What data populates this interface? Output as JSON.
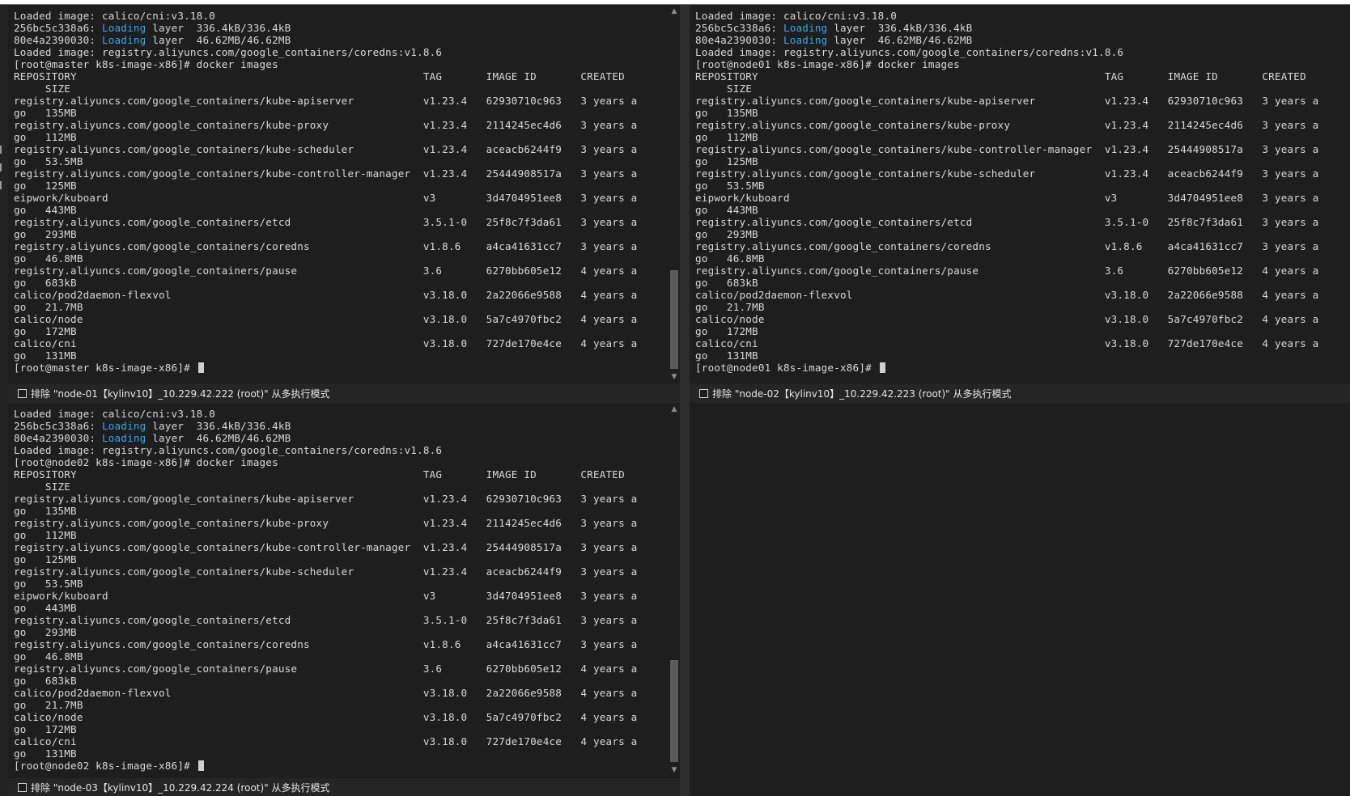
{
  "panes": [
    {
      "id": "pane-master",
      "lines": [
        {
          "t": "Loaded image: calico/cni:v3.18.0"
        },
        {
          "segments": [
            "256bc5c338a6: ",
            "Loading",
            " layer  336.4kB/336.4kB"
          ]
        },
        {
          "segments": [
            "80e4a2390030: ",
            "Loading",
            " layer  46.62MB/46.62MB"
          ]
        },
        {
          "t": "Loaded image: registry.aliyuncs.com/google_containers/coredns:v1.8.6"
        },
        {
          "t": "[root@master k8s-image-x86]# docker images"
        },
        {
          "t": "REPOSITORY                                                       TAG       IMAGE ID       CREATED"
        },
        {
          "t": "     SIZE"
        },
        {
          "t": "registry.aliyuncs.com/google_containers/kube-apiserver           v1.23.4   62930710c963   3 years a"
        },
        {
          "t": "go   135MB"
        },
        {
          "t": "registry.aliyuncs.com/google_containers/kube-proxy               v1.23.4   2114245ec4d6   3 years a"
        },
        {
          "t": "go   112MB"
        },
        {
          "t": "registry.aliyuncs.com/google_containers/kube-scheduler           v1.23.4   aceacb6244f9   3 years a"
        },
        {
          "t": "go   53.5MB"
        },
        {
          "t": "registry.aliyuncs.com/google_containers/kube-controller-manager  v1.23.4   25444908517a   3 years a"
        },
        {
          "t": "go   125MB"
        },
        {
          "t": "eipwork/kuboard                                                  v3        3d4704951ee8   3 years a"
        },
        {
          "t": "go   443MB"
        },
        {
          "t": "registry.aliyuncs.com/google_containers/etcd                     3.5.1-0   25f8c7f3da61   3 years a"
        },
        {
          "t": "go   293MB"
        },
        {
          "t": "registry.aliyuncs.com/google_containers/coredns                  v1.8.6    a4ca41631cc7   3 years a"
        },
        {
          "t": "go   46.8MB"
        },
        {
          "t": "registry.aliyuncs.com/google_containers/pause                    3.6       6270bb605e12   4 years a"
        },
        {
          "t": "go   683kB"
        },
        {
          "t": "calico/pod2daemon-flexvol                                        v3.18.0   2a22066e9588   4 years a"
        },
        {
          "t": "go   21.7MB"
        },
        {
          "t": "calico/node                                                      v3.18.0   5a7c4970fbc2   4 years a"
        },
        {
          "t": "go   172MB"
        },
        {
          "t": "calico/cni                                                       v3.18.0   727de170e4ce   4 years a"
        },
        {
          "t": "go   131MB"
        },
        {
          "t": "[root@master k8s-image-x86]# ",
          "cursor": true
        }
      ],
      "status": "排除 \"node-01【kylinv10】_10.229.42.222 (root)\" 从多执行模式"
    },
    {
      "id": "pane-node01",
      "lines": [
        {
          "t": "Loaded image: calico/cni:v3.18.0"
        },
        {
          "segments": [
            "256bc5c338a6: ",
            "Loading",
            " layer  336.4kB/336.4kB"
          ]
        },
        {
          "segments": [
            "80e4a2390030: ",
            "Loading",
            " layer  46.62MB/46.62MB"
          ]
        },
        {
          "t": "Loaded image: registry.aliyuncs.com/google_containers/coredns:v1.8.6"
        },
        {
          "t": "[root@node01 k8s-image-x86]# docker images"
        },
        {
          "t": "REPOSITORY                                                       TAG       IMAGE ID       CREATED"
        },
        {
          "t": "     SIZE"
        },
        {
          "t": "registry.aliyuncs.com/google_containers/kube-apiserver           v1.23.4   62930710c963   3 years a"
        },
        {
          "t": "go   135MB"
        },
        {
          "t": "registry.aliyuncs.com/google_containers/kube-proxy               v1.23.4   2114245ec4d6   3 years a"
        },
        {
          "t": "go   112MB"
        },
        {
          "t": "registry.aliyuncs.com/google_containers/kube-controller-manager  v1.23.4   25444908517a   3 years a"
        },
        {
          "t": "go   125MB"
        },
        {
          "t": "registry.aliyuncs.com/google_containers/kube-scheduler           v1.23.4   aceacb6244f9   3 years a"
        },
        {
          "t": "go   53.5MB"
        },
        {
          "t": "eipwork/kuboard                                                  v3        3d4704951ee8   3 years a"
        },
        {
          "t": "go   443MB"
        },
        {
          "t": "registry.aliyuncs.com/google_containers/etcd                     3.5.1-0   25f8c7f3da61   3 years a"
        },
        {
          "t": "go   293MB"
        },
        {
          "t": "registry.aliyuncs.com/google_containers/coredns                  v1.8.6    a4ca41631cc7   3 years a"
        },
        {
          "t": "go   46.8MB"
        },
        {
          "t": "registry.aliyuncs.com/google_containers/pause                    3.6       6270bb605e12   4 years a"
        },
        {
          "t": "go   683kB"
        },
        {
          "t": "calico/pod2daemon-flexvol                                        v3.18.0   2a22066e9588   4 years a"
        },
        {
          "t": "go   21.7MB"
        },
        {
          "t": "calico/node                                                      v3.18.0   5a7c4970fbc2   4 years a"
        },
        {
          "t": "go   172MB"
        },
        {
          "t": "calico/cni                                                       v3.18.0   727de170e4ce   4 years a"
        },
        {
          "t": "go   131MB"
        },
        {
          "t": "[root@node01 k8s-image-x86]# ",
          "cursor": true
        }
      ],
      "status": "排除 \"node-02【kylinv10】_10.229.42.223 (root)\" 从多执行模式"
    },
    {
      "id": "pane-node02",
      "lines": [
        {
          "t": "Loaded image: calico/cni:v3.18.0"
        },
        {
          "segments": [
            "256bc5c338a6: ",
            "Loading",
            " layer  336.4kB/336.4kB"
          ]
        },
        {
          "segments": [
            "80e4a2390030: ",
            "Loading",
            " layer  46.62MB/46.62MB"
          ]
        },
        {
          "t": "Loaded image: registry.aliyuncs.com/google_containers/coredns:v1.8.6"
        },
        {
          "t": "[root@node02 k8s-image-x86]# docker images"
        },
        {
          "t": "REPOSITORY                                                       TAG       IMAGE ID       CREATED"
        },
        {
          "t": "     SIZE"
        },
        {
          "t": "registry.aliyuncs.com/google_containers/kube-apiserver           v1.23.4   62930710c963   3 years a"
        },
        {
          "t": "go   135MB"
        },
        {
          "t": "registry.aliyuncs.com/google_containers/kube-proxy               v1.23.4   2114245ec4d6   3 years a"
        },
        {
          "t": "go   112MB"
        },
        {
          "t": "registry.aliyuncs.com/google_containers/kube-controller-manager  v1.23.4   25444908517a   3 years a"
        },
        {
          "t": "go   125MB"
        },
        {
          "t": "registry.aliyuncs.com/google_containers/kube-scheduler           v1.23.4   aceacb6244f9   3 years a"
        },
        {
          "t": "go   53.5MB"
        },
        {
          "t": "eipwork/kuboard                                                  v3        3d4704951ee8   3 years a"
        },
        {
          "t": "go   443MB"
        },
        {
          "t": "registry.aliyuncs.com/google_containers/etcd                     3.5.1-0   25f8c7f3da61   3 years a"
        },
        {
          "t": "go   293MB"
        },
        {
          "t": "registry.aliyuncs.com/google_containers/coredns                  v1.8.6    a4ca41631cc7   3 years a"
        },
        {
          "t": "go   46.8MB"
        },
        {
          "t": "registry.aliyuncs.com/google_containers/pause                    3.6       6270bb605e12   4 years a"
        },
        {
          "t": "go   683kB"
        },
        {
          "t": "calico/pod2daemon-flexvol                                        v3.18.0   2a22066e9588   4 years a"
        },
        {
          "t": "go   21.7MB"
        },
        {
          "t": "calico/node                                                      v3.18.0   5a7c4970fbc2   4 years a"
        },
        {
          "t": "go   172MB"
        },
        {
          "t": "calico/cni                                                       v3.18.0   727de170e4ce   4 years a"
        },
        {
          "t": "go   131MB"
        },
        {
          "t": "[root@node02 k8s-image-x86]# ",
          "cursor": true
        }
      ],
      "status": "排除 \"node-03【kylinv10】_10.229.42.224 (root)\" 从多执行模式"
    }
  ],
  "colors": {
    "background": "#1e1e1e",
    "text": "#d9d9d9",
    "highlight": "#3aa6e8",
    "statusbar": "#252526"
  },
  "icons": {
    "scroll_up": "▲",
    "scroll_down": "▼"
  }
}
